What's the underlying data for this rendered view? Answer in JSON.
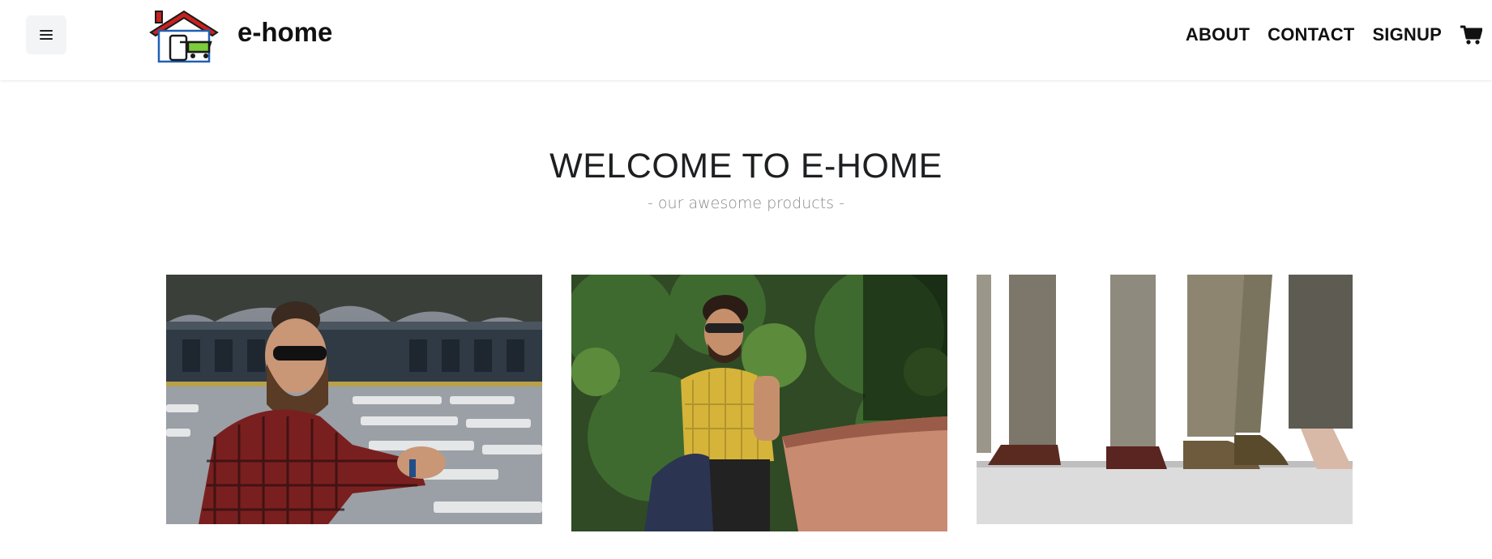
{
  "brand": {
    "name": "e-home",
    "logo_icon": "house-cart-icon"
  },
  "nav": {
    "menu_icon": "hamburger-icon",
    "links": [
      "ABOUT",
      "CONTACT",
      "SIGNUP"
    ],
    "cart_icon": "shopping-cart-icon"
  },
  "hero": {
    "title": "WELCOME TO E-HOME",
    "subtitle": "- our awesome products -"
  },
  "products": [
    {
      "image": "man-with-beard-and-sunglasses-plaid-shirt"
    },
    {
      "image": "man-in-yellow-shirt-holding-jacket"
    },
    {
      "image": "people-legs-in-trousers-and-shoes"
    }
  ],
  "colors": {
    "background": "#ffffff",
    "text": "#212529",
    "subtitle": "#8a8a8a",
    "logo_roof": "#c8211f",
    "logo_cart": "#7dcc3a",
    "logo_house": "#1f5fb4"
  }
}
